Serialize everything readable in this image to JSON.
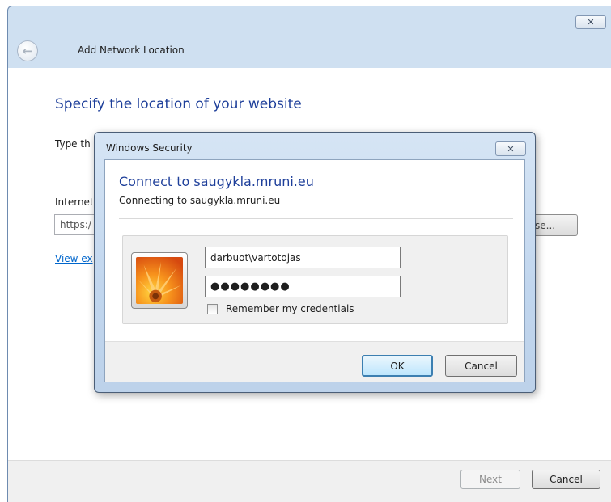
{
  "wizard": {
    "title": "Add Network Location",
    "heading": "Specify the location of your website",
    "type_label": "Type th",
    "internet_label": "Internet",
    "address_value": "https:/",
    "browse_label": "se...",
    "view_link": "View ex",
    "next_label": "Next",
    "cancel_label": "Cancel",
    "close_icon": "close-icon",
    "back_icon": "back-arrow-icon"
  },
  "security": {
    "title": "Windows Security",
    "heading": "Connect to saugykla.mruni.eu",
    "subheading": "Connecting to saugykla.mruni.eu",
    "username_value": "darbuot\\vartotojas",
    "password_mask": "●●●●●●●●",
    "remember_label": "Remember my credentials",
    "remember_checked": false,
    "ok_label": "OK",
    "cancel_label": "Cancel",
    "close_icon": "close-icon",
    "user_picture": "flower-user-icon"
  },
  "colors": {
    "heading_blue": "#1e3f9a",
    "link_blue": "#0066cc",
    "frame_blue": "#cfe0f1",
    "default_button_border": "#3c7fb1"
  }
}
